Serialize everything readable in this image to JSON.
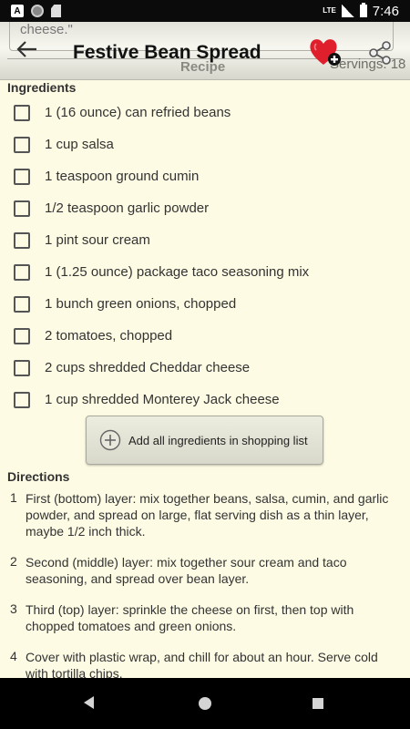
{
  "status_bar": {
    "time": "7:46",
    "network": "LTE",
    "left_icons": [
      "app-notification-icon",
      "circle-icon",
      "sd-card-icon"
    ],
    "app_icon_letter": "A"
  },
  "header": {
    "behind_text": "cheese.\"",
    "title": "Festive Bean Spread",
    "subtitle": "Recipe",
    "servings": "Servings: 18",
    "icons": [
      "back-arrow-icon",
      "heart-add-favorite-icon",
      "share-icon"
    ]
  },
  "ingredients": {
    "title": "Ingredients",
    "items": [
      "1 (16 ounce) can refried beans",
      "1 cup salsa",
      "1 teaspoon ground cumin",
      "1/2 teaspoon garlic powder",
      "1 pint sour cream",
      "1 (1.25 ounce) package taco seasoning mix",
      "1 bunch green onions, chopped",
      "2 tomatoes, chopped",
      "2 cups shredded Cheddar cheese",
      "1 cup shredded Monterey Jack cheese"
    ],
    "add_button_label": "Add all ingredients in shopping list"
  },
  "directions": {
    "title": "Directions",
    "steps": [
      {
        "num": "1",
        "text": "First (bottom) layer: mix together beans, salsa, cumin, and garlic powder, and spread on large, flat serving dish as a thin layer, maybe 1/2 inch thick."
      },
      {
        "num": "2",
        "text": "Second (middle) layer: mix together sour cream and taco seasoning, and spread over bean layer."
      },
      {
        "num": "3",
        "text": "Third (top) layer: sprinkle the cheese on first, then top with chopped tomatoes and green onions."
      },
      {
        "num": "4",
        "text": "Cover with plastic wrap, and chill for about an hour. Serve cold with tortilla chips."
      }
    ]
  },
  "colors": {
    "background": "#fdfbe3",
    "heart": "#e01f2d",
    "status_bar": "#0b0b0b",
    "nav_bar": "#000000"
  }
}
